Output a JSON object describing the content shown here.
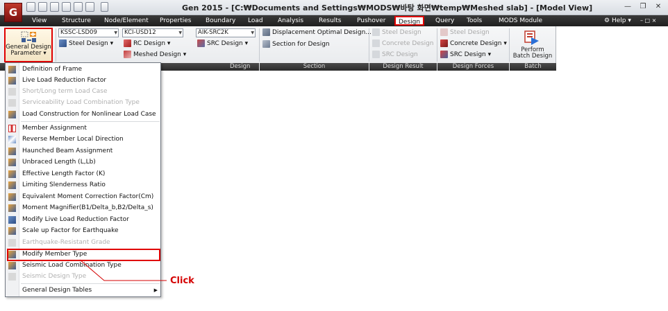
{
  "app": {
    "logo": "G",
    "title": "Gen 2015 - [C:₩Documents and Settings₩MODS₩바탕 화면₩temp₩Meshed slab] - [Model View]"
  },
  "menubar": {
    "items": [
      "View",
      "Structure",
      "Node/Element",
      "Properties",
      "Boundary",
      "Load",
      "Analysis",
      "Results",
      "Pushover",
      "Design",
      "Query",
      "Tools",
      "MODS Module"
    ],
    "help": "Help"
  },
  "ribbon": {
    "general_design_param": {
      "line1": "General Design",
      "line2": "Parameter"
    },
    "code_combos": [
      "KSSC-LSD09",
      "KCI-USD12",
      "AIK-SRC2K"
    ],
    "design_buttons": [
      "Steel Design",
      "RC Design",
      "SRC Design",
      "Meshed Design"
    ],
    "section_buttons": [
      "Displacement Optimal Design...",
      "Section for Design"
    ],
    "result_buttons": [
      "Steel Design",
      "Concrete Design",
      "SRC Design"
    ],
    "force_buttons": [
      "Steel Design",
      "Concrete Design",
      "SRC Design"
    ],
    "batch": {
      "line1": "Perform",
      "line2": "Batch Design"
    },
    "groups": [
      "Design",
      "Section",
      "Design Result",
      "Design Forces",
      "Batch"
    ]
  },
  "dropdown": {
    "items": [
      {
        "label": "Definition of Frame",
        "enabled": true
      },
      {
        "label": "Live Load Reduction Factor",
        "enabled": true
      },
      {
        "label": "Short/Long term Load Case",
        "enabled": false
      },
      {
        "label": "Serviceability Load Combination Type",
        "enabled": false
      },
      {
        "label": "Load Construction for Nonlinear Load Case",
        "enabled": true
      },
      {
        "label": "Member Assignment",
        "enabled": true
      },
      {
        "label": "Reverse Member Local Direction",
        "enabled": true
      },
      {
        "label": "Haunched Beam Assignment",
        "enabled": true
      },
      {
        "label": "Unbraced Length (L,Lb)",
        "enabled": true
      },
      {
        "label": "Effective Length Factor (K)",
        "enabled": true
      },
      {
        "label": "Limiting Slenderness Ratio",
        "enabled": true
      },
      {
        "label": "Equivalent Moment Correction Factor(Cm)",
        "enabled": true
      },
      {
        "label": "Moment Magnifier(B1/Delta_b,B2/Delta_s)",
        "enabled": true
      },
      {
        "label": "Modify Live Load Reduction Factor",
        "enabled": true
      },
      {
        "label": "Scale up Factor for Earthquake",
        "enabled": true
      },
      {
        "label": "Earthquake-Resistant Grade",
        "enabled": false
      },
      {
        "label": "Modify Member Type",
        "enabled": true
      },
      {
        "label": "Seismic Load Combination Type",
        "enabled": true
      },
      {
        "label": "Seismic Design Type",
        "enabled": false
      },
      {
        "label": "General Design Tables",
        "enabled": true
      }
    ]
  },
  "annotation": {
    "click_label": "Click"
  },
  "colors": {
    "highlight": "#e00000",
    "menubar": "#2b2b2b",
    "disabled": "#b0b0b0"
  }
}
